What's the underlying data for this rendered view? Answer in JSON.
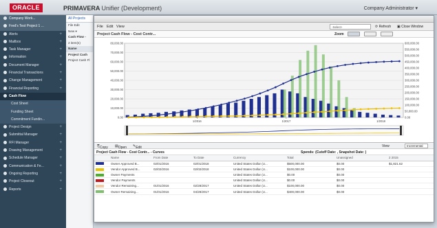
{
  "app": {
    "logo_text": "ORACLE",
    "brand": "PRIMAVERA",
    "brand_sub": "Unifier (Development)",
    "user_menu": "Company Administrator ▾"
  },
  "sidebar": {
    "top": "Company Work...",
    "items": [
      {
        "label": "Fred's Test Project 1 ...",
        "type": "top"
      },
      {
        "label": "Alerts"
      },
      {
        "label": "Mailbox"
      },
      {
        "label": "Task Manager"
      },
      {
        "label": "Information"
      },
      {
        "label": "Document Manager"
      },
      {
        "label": "Financial Transactions"
      },
      {
        "label": "Change Management"
      },
      {
        "label": "Financial Reporting"
      },
      {
        "label": "Cash Flow",
        "type": "active"
      },
      {
        "label": "Cost Sheet",
        "type": "sub"
      },
      {
        "label": "Funding Sheet",
        "type": "sub"
      },
      {
        "label": "Commitment Fundin...",
        "type": "sub"
      },
      {
        "label": "Project Design"
      },
      {
        "label": "Submittal Manager"
      },
      {
        "label": "RFI Manager"
      },
      {
        "label": "Drawing Management"
      },
      {
        "label": "Schedule Manager"
      },
      {
        "label": "Communication & Fe..."
      },
      {
        "label": "Ongoing Reporting"
      },
      {
        "label": "Project Closeout"
      },
      {
        "label": "Reports"
      }
    ]
  },
  "midpanel": {
    "tab": "All Projects",
    "menu": "File  Edit",
    "toolbar": "New ▾",
    "rows": [
      "Cash Flow -",
      "2 item(s)",
      "Name",
      "Project Cash",
      "Project Cash Fl"
    ]
  },
  "window": {
    "menu": [
      "File",
      "Edit",
      "View"
    ],
    "search": "-Select-",
    "refresh": "Refresh",
    "close": "Close Window",
    "chart_title": "Project Cash Flow - Cost Contr...",
    "zoom_label": "Zoom",
    "zoom_buttons": [
      "Year",
      "",
      ""
    ]
  },
  "chart_data": {
    "type": "bar",
    "x_ticks": [
      "1/2016",
      "1/2017",
      "1/2018"
    ],
    "y_left_ticks": [
      "0.00",
      "10,000.00",
      "20,000.00",
      "30,000.00",
      "40,000.00",
      "50,000.00",
      "60,000.00",
      "70,000.00",
      "80,000.00"
    ],
    "y_right_ticks": [
      "0.00",
      "50,000.00",
      "100,000.00",
      "150,000.00",
      "200,000.00",
      "250,000.00",
      "300,000.00",
      "350,000.00",
      "400,000.00",
      "450,000.00",
      "500,000.00",
      "550,000.00",
      "600,000.00"
    ],
    "ylim_left": [
      0,
      80000
    ],
    "ylim_right": [
      0,
      600000
    ],
    "series": [
      {
        "name": "Owner Approved B...",
        "color": "#1f2f8f",
        "kind": "bar",
        "values": [
          2500,
          3000,
          4000,
          4500,
          5000,
          6000,
          6500,
          7500,
          8500,
          9000,
          10000,
          12000,
          13000,
          15000,
          16000,
          18000,
          20000,
          22000,
          24000,
          26000,
          30000,
          28000,
          26000,
          22000,
          20000,
          18000,
          15000,
          12000,
          10000,
          8000,
          6000,
          5000,
          4000,
          3000,
          2500,
          2000
        ]
      },
      {
        "name": "Vendor Approved B...",
        "color": "#e8c400",
        "kind": "bar",
        "values": [
          0,
          0,
          0,
          0,
          0,
          0,
          0,
          0,
          0,
          0,
          0,
          0,
          0,
          0,
          0,
          0,
          0,
          0,
          0,
          0,
          0,
          0,
          0,
          0,
          0,
          0,
          0,
          0,
          0,
          0,
          0,
          0,
          0,
          0,
          0,
          0
        ]
      },
      {
        "name": "Owner Payments",
        "color": "#4caf2a",
        "kind": "bar",
        "values": [
          0,
          0,
          0,
          0,
          0,
          0,
          0,
          0,
          0,
          0,
          0,
          0,
          0,
          0,
          0,
          0,
          0,
          0,
          0,
          0,
          0,
          0,
          0,
          0,
          0,
          0,
          0,
          0,
          0,
          0,
          0,
          0,
          0,
          0,
          0,
          0
        ]
      },
      {
        "name": "Vendor Payments",
        "color": "#c0161c",
        "kind": "bar",
        "values": [
          0,
          0,
          0,
          0,
          0,
          0,
          0,
          0,
          0,
          0,
          0,
          0,
          0,
          0,
          0,
          0,
          0,
          0,
          0,
          0,
          0,
          0,
          0,
          0,
          0,
          0,
          0,
          0,
          0,
          0,
          0,
          0,
          0,
          0,
          0,
          0
        ]
      },
      {
        "name": "Vendor Remaining...",
        "color": "#f2c9a0",
        "kind": "bar",
        "values": [
          0,
          0,
          0,
          0,
          0,
          0,
          0,
          0,
          0,
          0,
          0,
          0,
          0,
          0,
          0,
          0,
          0,
          0,
          0,
          0,
          0,
          0,
          0,
          0,
          0,
          0,
          0,
          0,
          0,
          0,
          0,
          0,
          0,
          0,
          0,
          0
        ]
      },
      {
        "name": "Owner Remaining...",
        "color": "#7fbf6e",
        "kind": "bar",
        "values": [
          0,
          0,
          0,
          0,
          0,
          0,
          0,
          0,
          0,
          0,
          0,
          0,
          0,
          0,
          0,
          0,
          0,
          0,
          0,
          0,
          30000,
          45000,
          62000,
          72000,
          78000,
          68000,
          55000,
          40000,
          22000,
          10000,
          0,
          0,
          0,
          0,
          0,
          0
        ]
      },
      {
        "name": "Cumulative Owner",
        "color": "#1f2f8f",
        "kind": "line",
        "values": [
          2000,
          5000,
          9000,
          14000,
          20000,
          27000,
          35000,
          44000,
          54000,
          65000,
          77000,
          90000,
          104000,
          119000,
          135000,
          152000,
          172000,
          194000,
          218000,
          244000,
          274000,
          302000,
          328000,
          350000,
          370000,
          388000,
          403000,
          415000,
          425000,
          433000,
          439000,
          444000,
          448000,
          451000,
          453000,
          455000
        ]
      },
      {
        "name": "Cumulative Vendor",
        "color": "#f2c200",
        "kind": "line",
        "values": [
          0,
          500,
          1000,
          1500,
          2000,
          3000,
          4000,
          5000,
          6000,
          7000,
          8000,
          9000,
          10000,
          11000,
          12000,
          14000,
          16000,
          18000,
          20000,
          23000,
          26000,
          30000,
          34000,
          38000,
          42000,
          46000,
          50000,
          54000,
          58000,
          62000,
          65000,
          68000,
          70000,
          72000,
          74000,
          75000
        ]
      }
    ]
  },
  "table": {
    "toolbar": [
      "Copy",
      "Open",
      "Edit"
    ],
    "view_label": "View",
    "view_value": "Incremental",
    "title": "Project Cash Flow - Cost Contr... - Curves",
    "spends": "Spends: (Cutoff Date: , Snapshot Date: )",
    "columns": [
      "",
      "Name",
      "From Date",
      "To Date",
      "Currency",
      "Total",
      "Unassigned",
      "2 2015"
    ],
    "rows": [
      {
        "color": "#1f2f8f",
        "name": "Owner Approved B...",
        "from": "02/01/2016",
        "to": "02/01/2018",
        "currency": "United States Dollar (U...",
        "total": "$500,000.00",
        "unassigned": "$0.00",
        "val": "$1,821.62"
      },
      {
        "color": "#e8c400",
        "name": "Vendor Approved B...",
        "from": "02/02/2016",
        "to": "02/02/2018",
        "currency": "United States Dollar (U...",
        "total": "$100,000.00",
        "unassigned": "$0.00",
        "val": ""
      },
      {
        "color": "#4caf2a",
        "name": "Owner Payments",
        "from": "",
        "to": "",
        "currency": "United States Dollar (U...",
        "total": "$0.00",
        "unassigned": "$0.00",
        "val": ""
      },
      {
        "color": "#c0161c",
        "name": "Vendor Payments",
        "from": "",
        "to": "",
        "currency": "United States Dollar (U...",
        "total": "$0.00",
        "unassigned": "$0.00",
        "val": ""
      },
      {
        "color": "#f2c9a0",
        "name": "Vendor Remaining...",
        "from": "01/01/2016",
        "to": "02/28/2017",
        "currency": "United States Dollar (U...",
        "total": "$100,000.00",
        "unassigned": "$0.00",
        "val": ""
      },
      {
        "color": "#7fbf6e",
        "name": "Owner Remaining...",
        "from": "01/01/2016",
        "to": "04/28/2017",
        "currency": "United States Dollar (U...",
        "total": "$400,000.00",
        "unassigned": "$0.00",
        "val": ""
      }
    ]
  }
}
